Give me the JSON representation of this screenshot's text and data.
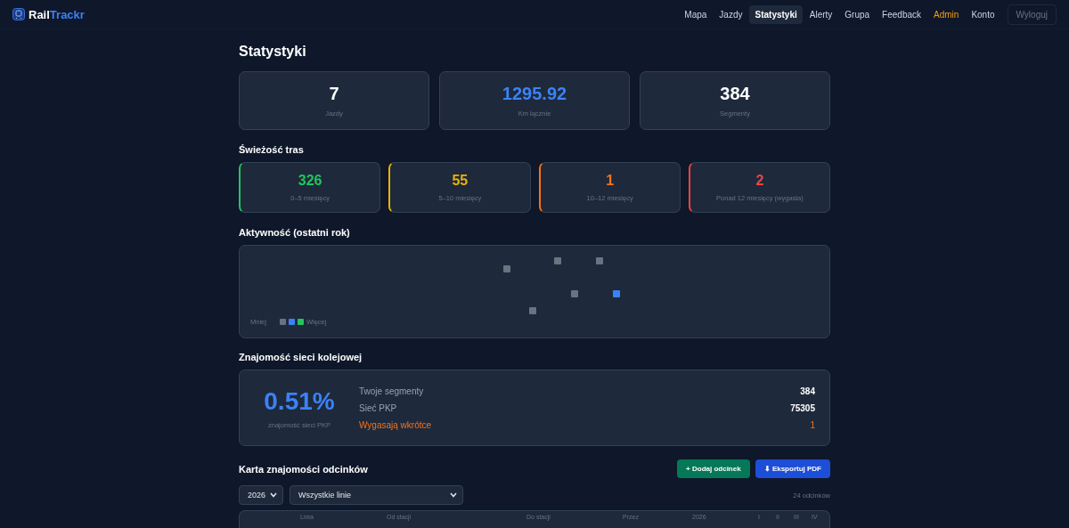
{
  "brand": {
    "first": "Rail",
    "second": "Trackr"
  },
  "nav": [
    {
      "label": "Mapa",
      "selected": false,
      "kind": "link"
    },
    {
      "label": "Jazdy",
      "selected": false,
      "kind": "link"
    },
    {
      "label": "Statystyki",
      "selected": true,
      "kind": "link"
    },
    {
      "label": "Alerty",
      "selected": false,
      "kind": "link"
    },
    {
      "label": "Grupa",
      "selected": false,
      "kind": "link"
    },
    {
      "label": "Feedback",
      "selected": false,
      "kind": "link"
    },
    {
      "label": "Admin",
      "selected": false,
      "kind": "admin"
    },
    {
      "label": "Konto",
      "selected": false,
      "kind": "link"
    },
    {
      "label": "Wyloguj",
      "selected": false,
      "kind": "outline"
    }
  ],
  "page_title": "Statystyki",
  "stats": [
    {
      "value": "7",
      "label": "Jazdy",
      "color": "#ffffff"
    },
    {
      "value": "1295.92",
      "label": "Km łącznie",
      "color": "#3b82f6"
    },
    {
      "value": "384",
      "label": "Segmenty",
      "color": "#ffffff"
    }
  ],
  "freshness": {
    "title": "Świeżość tras",
    "cards": [
      {
        "value": "326",
        "label": "0–5 miesięcy",
        "color": "#22c55e"
      },
      {
        "value": "55",
        "label": "5–10 miesięcy",
        "color": "#eab308"
      },
      {
        "value": "1",
        "label": "10–12 miesięcy",
        "color": "#f97316"
      },
      {
        "value": "2",
        "label": "Ponad 12 miesięcy (wygasła)",
        "color": "#ef4444"
      }
    ]
  },
  "activity": {
    "title": "Aktywność (ostatni rok)",
    "legend_less": "Mniej",
    "legend_more": "Więcej"
  },
  "network": {
    "title": "Znajomość sieci kolejowej",
    "percent": "0.51%",
    "percent_label": "znajomość sieci PKP",
    "rows": [
      {
        "label": "Twoje segmenty",
        "value": "384",
        "kind": "normal"
      },
      {
        "label": "Sieć PKP",
        "value": "75305",
        "kind": "normal"
      },
      {
        "label": "Wygasają wkrótce",
        "value": "1",
        "kind": "warning"
      }
    ]
  },
  "segments": {
    "title": "Karta znajomości odcinków",
    "add_button": "+ Dodaj odcinek",
    "export_button": "⬇ Eksportuj PDF",
    "year": "2026",
    "line_filter": "Wszystkie linie",
    "count": "24 odcinków",
    "columns": [
      "Linia",
      "Od stacji",
      "Do stacji",
      "Przez",
      "2026",
      "I",
      "II",
      "III",
      "IV"
    ]
  }
}
